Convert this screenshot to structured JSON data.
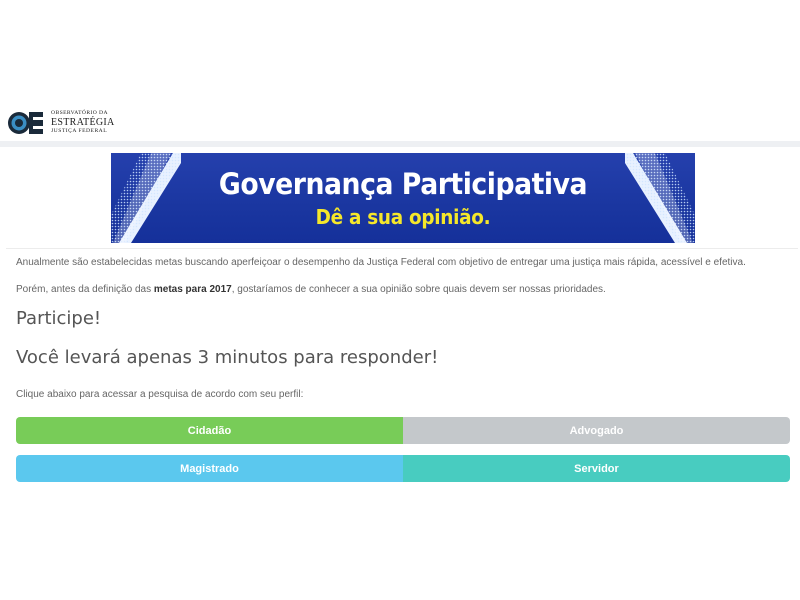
{
  "logo": {
    "line1": "OBSERVATÓRIO DA",
    "line2": "ESTRATÉGIA",
    "line3": "JUSTIÇA FEDERAL",
    "icon": "oe-logo-mark"
  },
  "banner": {
    "title": "Governança Participativa",
    "subtitle": "Dê a sua opinião.",
    "background_color": "#1f3aa3",
    "subtitle_color": "#f5e72a",
    "icons": [
      "microphone-icon",
      "microphone-icon"
    ]
  },
  "intro": {
    "paragraph1": "Anualmente são estabelecidas metas buscando aperfeiçoar o desempenho da Justiça Federal com objetivo de entregar uma justiça mais rápida, acessível e efetiva.",
    "paragraph2_before": "Porém, antes da definição das ",
    "paragraph2_bold": "metas para 2017",
    "paragraph2_after": ", gostaríamos de conhecer a sua opinião sobre quais devem ser nossas prioridades."
  },
  "headings": {
    "participe": "Participe!",
    "minutes": "Você levará apenas 3 minutos para responder!"
  },
  "instructions": "Clique abaixo para acessar a pesquisa de acordo com seu perfil:",
  "profiles": [
    {
      "label": "Cidadão",
      "color": "#78cc58"
    },
    {
      "label": "Advogado",
      "color": "#c4c8cb"
    },
    {
      "label": "Magistrado",
      "color": "#5bc8ee"
    },
    {
      "label": "Servidor",
      "color": "#48ccc0"
    }
  ]
}
